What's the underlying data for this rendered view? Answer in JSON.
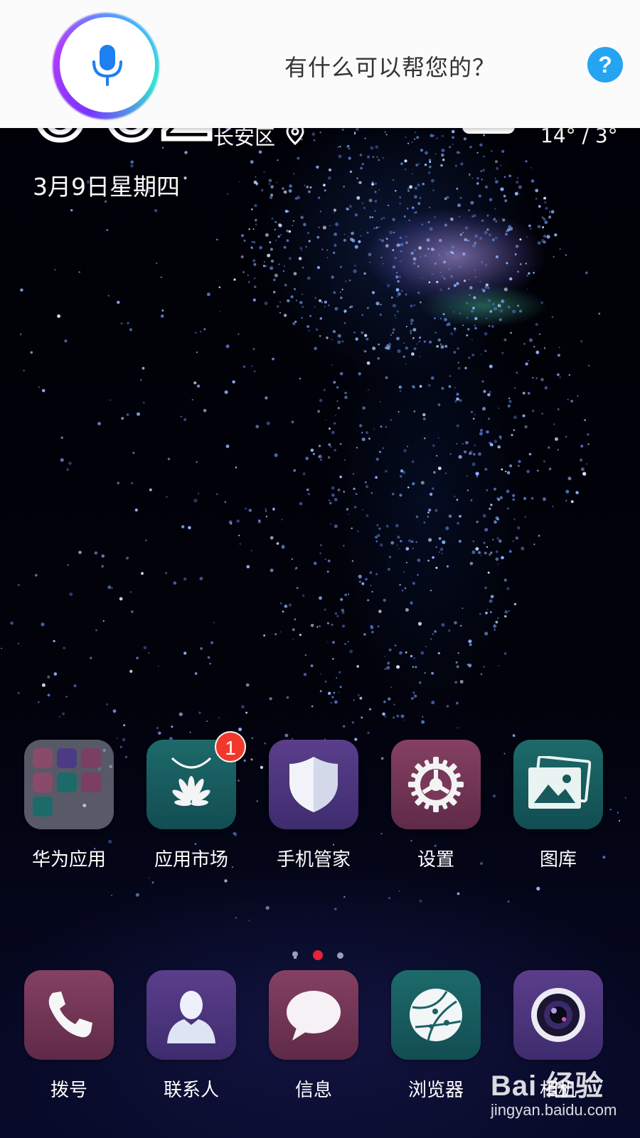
{
  "assistant": {
    "prompt": "有什么可以帮您的？",
    "help_label": "?",
    "accent_colors": [
      "#7a35ff",
      "#2fe6d0",
      "#25a4f2"
    ]
  },
  "clock_widget": {
    "time_fragment": "0 0 2",
    "district": "长安区",
    "temperature": "14° / 3°",
    "date": "3月9日星期四"
  },
  "apps": [
    {
      "label": "华为应用",
      "icon": "folder-icon",
      "badge": ""
    },
    {
      "label": "应用市场",
      "icon": "huawei-appgallery-icon",
      "badge": "1"
    },
    {
      "label": "手机管家",
      "icon": "shield-icon",
      "badge": ""
    },
    {
      "label": "设置",
      "icon": "gear-icon",
      "badge": ""
    },
    {
      "label": "图库",
      "icon": "gallery-icon",
      "badge": ""
    }
  ],
  "pager": {
    "pages": 2,
    "active": 1
  },
  "dock": [
    {
      "label": "拨号",
      "icon": "phone-icon"
    },
    {
      "label": "联系人",
      "icon": "contact-icon"
    },
    {
      "label": "信息",
      "icon": "message-icon"
    },
    {
      "label": "浏览器",
      "icon": "browser-icon"
    },
    {
      "label": "相机",
      "icon": "camera-icon"
    }
  ],
  "watermark": {
    "brand": "Bai 经验",
    "site": "jingyan.baidu.com"
  }
}
